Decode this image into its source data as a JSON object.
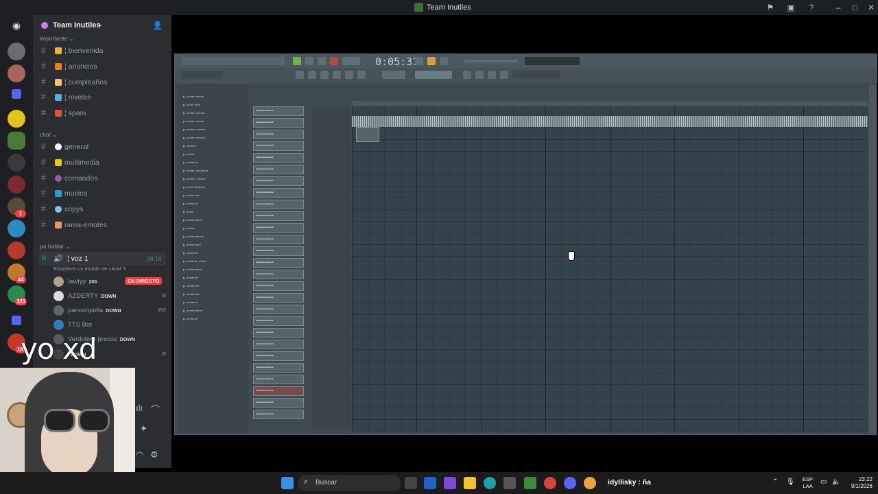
{
  "window": {
    "title": "Team Inutiles"
  },
  "server": {
    "name": "Team Inutiles"
  },
  "categories": {
    "importante": "importante",
    "chat": "chat",
    "pa_hablar": "pa hablar"
  },
  "channels": [
    {
      "name": "¦ bienvenida",
      "emoji": "👋",
      "color": "#f0b232"
    },
    {
      "name": "¦ anuncios",
      "emoji": "📣",
      "color": "#e67e22"
    },
    {
      "name": "¦ cumpleaños",
      "emoji": "🎂",
      "color": "#f0c674"
    },
    {
      "name": "¦ niveles",
      "emoji": "📊",
      "color": "#5dade2"
    },
    {
      "name": "¦ spam",
      "emoji": "📢",
      "color": "#e74c3c"
    },
    {
      "name": "general",
      "emoji": "💬",
      "color": "#ffffff"
    },
    {
      "name": "multimedia",
      "emoji": "📁",
      "color": "#f1c40f"
    },
    {
      "name": "comandos",
      "emoji": "🤖",
      "color": "#9b59b6"
    },
    {
      "name": "musica",
      "emoji": "🎵",
      "color": "#3498db"
    },
    {
      "name": "copys",
      "emoji": "💿",
      "color": "#85c1e9"
    },
    {
      "name": "rama-emotes",
      "emoji": "🧍",
      "color": "#e59866"
    }
  ],
  "voice": {
    "name": "¦ voz 1",
    "time": "28:18",
    "status_prompt": "Establece un estado de canal",
    "users": [
      {
        "name": "lawtyy",
        "tag": "200",
        "live": "EN DIRECTO"
      },
      {
        "name": "AZDERTY",
        "tag": "DOWN"
      },
      {
        "name": "panconpolla",
        "tag": "DOWN"
      },
      {
        "name": "TTS Bot",
        "tag": ""
      },
      {
        "name": "Verdulero precoz",
        "tag": "DOWN"
      },
      {
        "name": "",
        "tag": "DOWN"
      }
    ]
  },
  "overlay_text": "yo xd",
  "guild_badges": [
    "1",
    "44",
    "321",
    "1K"
  ],
  "fl_studio": {
    "time": "0:05:31"
  },
  "taskbar": {
    "search_placeholder": "Buscar",
    "now_playing": "idyllisky : ña",
    "lang_top": "ESP",
    "lang_bottom": "LAA",
    "time": "23:22",
    "date": "9/1/2026"
  }
}
